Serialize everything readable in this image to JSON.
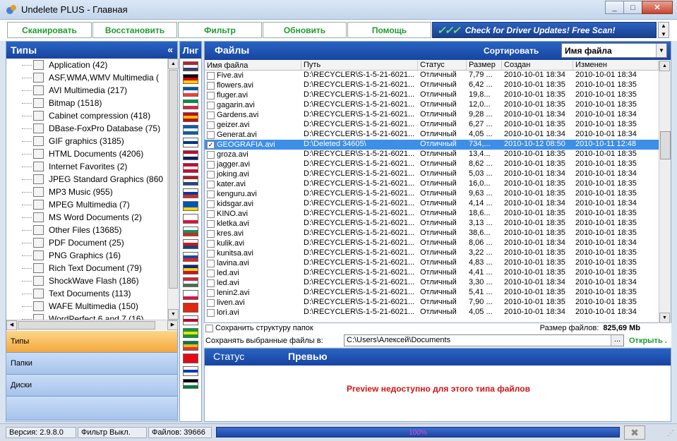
{
  "window": {
    "title": "Undelete PLUS -  Главная",
    "controls": [
      "_",
      "□",
      "✕"
    ]
  },
  "toolbar": {
    "scan": "Сканировать",
    "restore": "Восстановить",
    "filter": "Фильтр",
    "refresh": "Обновить",
    "help": "Помощь",
    "promo_checks": "✓✓✓",
    "promo_text": "Check for Driver Updates! Free Scan!"
  },
  "types_panel": {
    "title": "Типы",
    "collapse": "«",
    "items": [
      {
        "label": "Application (42)",
        "icon": "application-icon"
      },
      {
        "label": "ASF,WMA,WMV Multimedia (",
        "icon": "media-icon"
      },
      {
        "label": "AVI Multimedia (217)",
        "icon": "media-icon"
      },
      {
        "label": "Bitmap (1518)",
        "icon": "bitmap-icon"
      },
      {
        "label": "Cabinet compression (418)",
        "icon": "archive-icon"
      },
      {
        "label": "DBase-FoxPro Database (75)",
        "icon": "database-icon"
      },
      {
        "label": "GIF graphics (3185)",
        "icon": "image-icon"
      },
      {
        "label": "HTML Documents (4206)",
        "icon": "html-icon"
      },
      {
        "label": "Internet Favorites (2)",
        "icon": "favorites-icon"
      },
      {
        "label": "JPEG Standard Graphics (860",
        "icon": "image-icon"
      },
      {
        "label": "MP3 Music (955)",
        "icon": "music-icon"
      },
      {
        "label": "MPEG Multimedia (7)",
        "icon": "media-icon"
      },
      {
        "label": "MS Word Documents (2)",
        "icon": "word-icon"
      },
      {
        "label": "Other Files (13685)",
        "icon": "file-icon"
      },
      {
        "label": "PDF Document (25)",
        "icon": "pdf-icon"
      },
      {
        "label": "PNG Graphics (16)",
        "icon": "image-icon"
      },
      {
        "label": "Rich Text Document (79)",
        "icon": "rtf-icon"
      },
      {
        "label": "ShockWave Flash (186)",
        "icon": "flash-icon"
      },
      {
        "label": "Text Documents (113)",
        "icon": "text-icon"
      },
      {
        "label": "WAFE Multimedia (150)",
        "icon": "media-icon"
      },
      {
        "label": "WordPerfect 6 and 7 (16)",
        "icon": "document-icon"
      }
    ],
    "nav": [
      "Типы",
      "Папки",
      "Диски"
    ]
  },
  "lang": {
    "title": "Лнг",
    "flags": [
      "us",
      "de",
      "fr",
      "it",
      "es",
      "gr",
      "fi",
      "no",
      "dk",
      "nl",
      "ru",
      "ua",
      "pl",
      "bg",
      "cz",
      "sk",
      "ro",
      "hu",
      "pl2",
      "cn",
      "jp",
      "br",
      "za",
      "tr",
      "il",
      "ps"
    ]
  },
  "files_panel": {
    "title": "Файлы",
    "sort_label": "Сортировать",
    "sort_value": "Имя файла",
    "columns": [
      "Имя файла",
      "Путь",
      "Статус",
      "Размер",
      "Создан",
      "Изменен"
    ],
    "rows": [
      [
        "Five.avi",
        "D:\\RECYCLER\\S-1-5-21-6021...",
        "Отличный",
        "7,79 ...",
        "2010-10-01 18:34",
        "2010-10-01 18:34"
      ],
      [
        "flowers.avi",
        "D:\\RECYCLER\\S-1-5-21-6021...",
        "Отличный",
        "6,42 ...",
        "2010-10-01 18:35",
        "2010-10-01 18:35"
      ],
      [
        "fluger.avi",
        "D:\\RECYCLER\\S-1-5-21-6021...",
        "Отличный",
        "19,8...",
        "2010-10-01 18:35",
        "2010-10-01 18:35"
      ],
      [
        "gagarin.avi",
        "D:\\RECYCLER\\S-1-5-21-6021...",
        "Отличный",
        "12,0...",
        "2010-10-01 18:35",
        "2010-10-01 18:35"
      ],
      [
        "Gardens.avi",
        "D:\\RECYCLER\\S-1-5-21-6021...",
        "Отличный",
        "9,28 ...",
        "2010-10-01 18:34",
        "2010-10-01 18:34"
      ],
      [
        "geizer.avi",
        "D:\\RECYCLER\\S-1-5-21-6021...",
        "Отличный",
        "6,27 ...",
        "2010-10-01 18:35",
        "2010-10-01 18:35"
      ],
      [
        "Generat.avi",
        "D:\\RECYCLER\\S-1-5-21-6021...",
        "Отличный",
        "4,05 ...",
        "2010-10-01 18:34",
        "2010-10-01 18:34"
      ],
      [
        "GEOGRAFIA.avi",
        "D:\\Deleted 34605\\",
        "Отличный",
        "734,...",
        "2010-10-12 08:50",
        "2010-10-11 12:48"
      ],
      [
        "groza.avi",
        "D:\\RECYCLER\\S-1-5-21-6021...",
        "Отличный",
        "13,4...",
        "2010-10-01 18:35",
        "2010-10-01 18:35"
      ],
      [
        "jagger.avi",
        "D:\\RECYCLER\\S-1-5-21-6021...",
        "Отличный",
        "8,62 ...",
        "2010-10-01 18:35",
        "2010-10-01 18:35"
      ],
      [
        "joking.avi",
        "D:\\RECYCLER\\S-1-5-21-6021...",
        "Отличный",
        "5,03 ...",
        "2010-10-01 18:34",
        "2010-10-01 18:34"
      ],
      [
        "kater.avi",
        "D:\\RECYCLER\\S-1-5-21-6021...",
        "Отличный",
        "16,0...",
        "2010-10-01 18:35",
        "2010-10-01 18:35"
      ],
      [
        "kenguru.avi",
        "D:\\RECYCLER\\S-1-5-21-6021...",
        "Отличный",
        "9,63 ...",
        "2010-10-01 18:35",
        "2010-10-01 18:35"
      ],
      [
        "kidsgar.avi",
        "D:\\RECYCLER\\S-1-5-21-6021...",
        "Отличный",
        "4,14 ...",
        "2010-10-01 18:34",
        "2010-10-01 18:34"
      ],
      [
        "KINO.avi",
        "D:\\RECYCLER\\S-1-5-21-6021...",
        "Отличный",
        "18,6...",
        "2010-10-01 18:35",
        "2010-10-01 18:35"
      ],
      [
        "kletka.avi",
        "D:\\RECYCLER\\S-1-5-21-6021...",
        "Отличный",
        "3,13 ...",
        "2010-10-01 18:35",
        "2010-10-01 18:35"
      ],
      [
        "kres.avi",
        "D:\\RECYCLER\\S-1-5-21-6021...",
        "Отличный",
        "38,6...",
        "2010-10-01 18:35",
        "2010-10-01 18:35"
      ],
      [
        "kulik.avi",
        "D:\\RECYCLER\\S-1-5-21-6021...",
        "Отличный",
        "8,06 ...",
        "2010-10-01 18:34",
        "2010-10-01 18:34"
      ],
      [
        "kunitsa.avi",
        "D:\\RECYCLER\\S-1-5-21-6021...",
        "Отличный",
        "3,22 ...",
        "2010-10-01 18:35",
        "2010-10-01 18:35"
      ],
      [
        "lavina.avi",
        "D:\\RECYCLER\\S-1-5-21-6021...",
        "Отличный",
        "4,83 ...",
        "2010-10-01 18:35",
        "2010-10-01 18:35"
      ],
      [
        "led.avi",
        "D:\\RECYCLER\\S-1-5-21-6021...",
        "Отличный",
        "4,41 ...",
        "2010-10-01 18:35",
        "2010-10-01 18:35"
      ],
      [
        "led.avi",
        "D:\\RECYCLER\\S-1-5-21-6021...",
        "Отличный",
        "3,30 ...",
        "2010-10-01 18:34",
        "2010-10-01 18:34"
      ],
      [
        "lenin2.avi",
        "D:\\RECYCLER\\S-1-5-21-6021...",
        "Отличный",
        "5,41 ...",
        "2010-10-01 18:35",
        "2010-10-01 18:35"
      ],
      [
        "liven.avi",
        "D:\\RECYCLER\\S-1-5-21-6021...",
        "Отличный",
        "7,90 ...",
        "2010-10-01 18:35",
        "2010-10-01 18:35"
      ],
      [
        "lori.avi",
        "D:\\RECYCLER\\S-1-5-21-6021...",
        "Отличный",
        "4,05 ...",
        "2010-10-01 18:34",
        "2010-10-01 18:34"
      ]
    ],
    "selected_row": 7
  },
  "options": {
    "keep_structure": "Сохранить структуру папок",
    "size_label": "Размер файлов:",
    "size_value": "825,69 Mb",
    "save_label": "Сохранять выбранные файлы в:",
    "save_path": "C:\\Users\\Алексей\\Documents",
    "browse": "...",
    "open": "Открыть ."
  },
  "preview": {
    "tab_status": "Статус",
    "tab_preview": "Превью",
    "message": "Preview недоступно для этого типа файлов"
  },
  "statusbar": {
    "version": "Версия: 2.9.8.0",
    "filter": "Фильтр Выкл.",
    "files": "Файлов: 39666",
    "progress": "100%",
    "stop": "✖"
  },
  "colors": {
    "header_blue": "#1f52b0",
    "button_green": "#1d9c2f",
    "active_tab": "#f3a83c",
    "selected_row": "#3d8ee6",
    "error_red": "#d01414"
  }
}
